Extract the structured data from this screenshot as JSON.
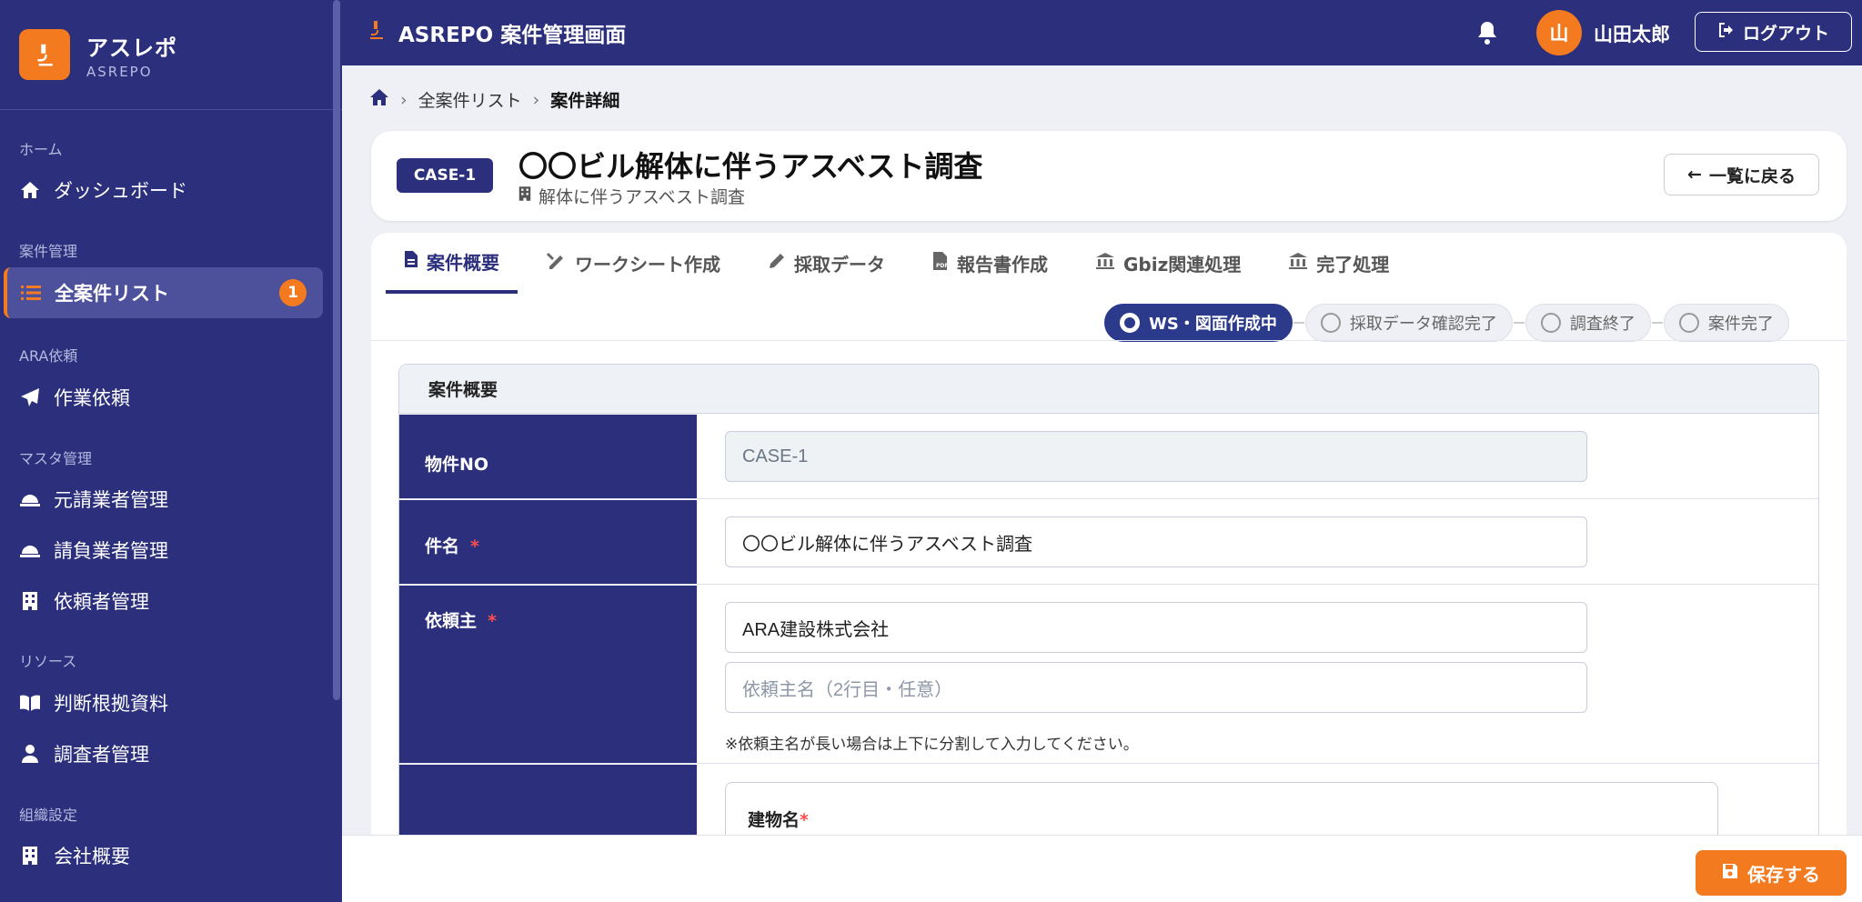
{
  "brand": {
    "name": "アスレポ",
    "sub": "ASREPO"
  },
  "sidebar": {
    "sections": [
      {
        "label": "ホーム"
      },
      {
        "label": "案件管理"
      },
      {
        "label": "ARA依頼"
      },
      {
        "label": "マスタ管理"
      },
      {
        "label": "リソース"
      },
      {
        "label": "組織設定"
      }
    ],
    "items": [
      {
        "label": "ダッシュボード",
        "icon": "home-icon"
      },
      {
        "label": "全案件リスト",
        "icon": "list-icon",
        "badge": "1",
        "active": true
      },
      {
        "label": "作業依頼",
        "icon": "paper-plane-icon"
      },
      {
        "label": "元請業者管理",
        "icon": "hard-hat-icon"
      },
      {
        "label": "請負業者管理",
        "icon": "hard-hat-icon"
      },
      {
        "label": "依頼者管理",
        "icon": "building-icon"
      },
      {
        "label": "判断根拠資料",
        "icon": "book-icon"
      },
      {
        "label": "調査者管理",
        "icon": "user-tie-icon"
      },
      {
        "label": "会社概要",
        "icon": "building-icon"
      }
    ]
  },
  "header": {
    "title": "ASREPO 案件管理画面",
    "avatar_initial": "山",
    "username": "山田太郎",
    "logout_label": "ログアウト"
  },
  "breadcrumb": {
    "home_icon": "home-icon",
    "list": "全案件リスト",
    "current": "案件詳細"
  },
  "case": {
    "badge": "CASE-1",
    "title": "〇〇ビル解体に伴うアスベスト調査",
    "subtitle": "解体に伴うアスベスト調査",
    "back_label": "一覧に戻る"
  },
  "tabs": [
    {
      "label": "案件概要",
      "icon": "file-icon",
      "active": true
    },
    {
      "label": "ワークシート作成",
      "icon": "pencil-ruler-icon"
    },
    {
      "label": "採取データ",
      "icon": "pen-icon"
    },
    {
      "label": "報告書作成",
      "icon": "pdf-file-icon"
    },
    {
      "label": "Gbiz関連処理",
      "icon": "bank-icon"
    },
    {
      "label": "完了処理",
      "icon": "bank-icon"
    }
  ],
  "steps": [
    {
      "label": "WS・図面作成中",
      "active": true
    },
    {
      "label": "採取データ確認完了"
    },
    {
      "label": "調査終了"
    },
    {
      "label": "案件完了"
    }
  ],
  "section": {
    "title": "案件概要",
    "rows": {
      "property_no": {
        "label": "物件NO",
        "value": "CASE-1"
      },
      "subject": {
        "label": "件名",
        "required": "*",
        "value": "〇〇ビル解体に伴うアスベスト調査"
      },
      "client": {
        "label": "依頼主",
        "required": "*",
        "value": "ARA建設株式会社",
        "placeholder2": "依頼主名（2行目・任意）",
        "note": "※依頼主名が長い場合は上下に分割して入力してください。"
      },
      "building": {
        "label": "建物名",
        "required": "*"
      }
    }
  },
  "footer": {
    "save_label": "保存する"
  },
  "colors": {
    "primary": "#2b2f7c",
    "accent": "#f47a1f"
  }
}
